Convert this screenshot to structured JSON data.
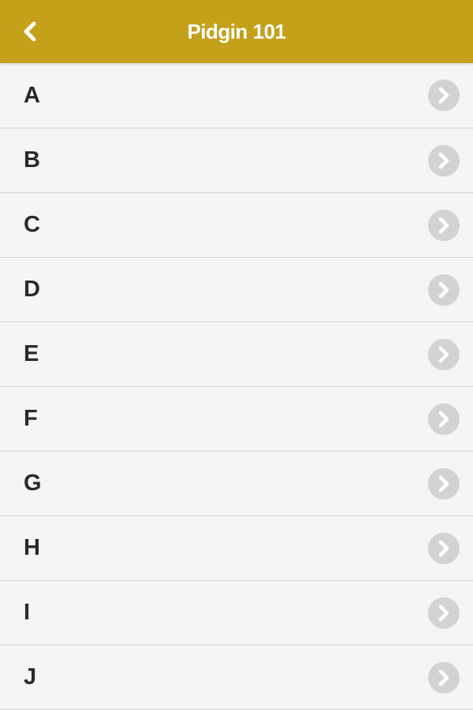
{
  "header": {
    "title": "Pidgin 101",
    "back_icon": "chevron-left-icon",
    "background_color": "#c5a01a"
  },
  "list": {
    "items": [
      {
        "label": "A",
        "icon": "chevron-right-circle-icon"
      },
      {
        "label": "B",
        "icon": "chevron-right-circle-icon"
      },
      {
        "label": "C",
        "icon": "chevron-right-circle-icon"
      },
      {
        "label": "D",
        "icon": "chevron-right-circle-icon"
      },
      {
        "label": "E",
        "icon": "chevron-right-circle-icon"
      },
      {
        "label": "F",
        "icon": "chevron-right-circle-icon"
      },
      {
        "label": "G",
        "icon": "chevron-right-circle-icon"
      },
      {
        "label": "H",
        "icon": "chevron-right-circle-icon"
      },
      {
        "label": "I",
        "icon": "chevron-right-circle-icon"
      },
      {
        "label": "J",
        "icon": "chevron-right-circle-icon"
      }
    ]
  }
}
